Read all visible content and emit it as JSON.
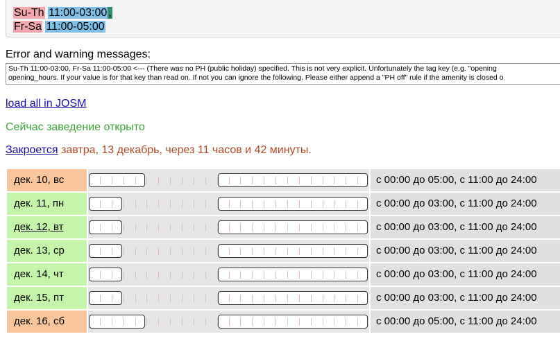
{
  "input": {
    "lines": [
      {
        "day": "Su-Th",
        "time": "11:00-03:00",
        "sep": ","
      },
      {
        "day": "Fr-Sa",
        "time": "11:00-05:00",
        "sep": ""
      }
    ]
  },
  "errors": {
    "label": "Error and warning messages:",
    "line1": "Su-Th 11:00-03:00, Fr-Sa 11:00-05:00 <--- (There was no PH (public holiday) specified. This is not very explicit. Unfortunately the tag key (e.g. \"opening",
    "line2": "opening_hours. If your value is for that key than read on. If not you can ignore the following. Please either append a \"PH off\" rule if the amenity is closed o"
  },
  "josm_link": "load all in JOSM",
  "status": {
    "open_text": "Сейчас заведение открыто",
    "closes_link": "Закроется",
    "closes_rest": " завтра, 13 декабрь, через 11 часов и 42 минуты."
  },
  "colors": {
    "weekend": "#f9c69c",
    "weekday": "#c5f5a9",
    "link": "#1a0dab",
    "open": "#3ea33a",
    "closes": "#b24a2a"
  },
  "days": [
    {
      "label": "дек. 10, вс",
      "type": "weekend",
      "underlined": false,
      "open_from_hour": 0,
      "open_until_hour": 5,
      "reopen_hour": 11,
      "desc": "с 00:00 до 05:00, с 11:00 до 24:00"
    },
    {
      "label": "дек. 11, пн",
      "type": "weekday",
      "underlined": false,
      "open_from_hour": 0,
      "open_until_hour": 3,
      "reopen_hour": 11,
      "desc": "с 00:00 до 03:00, с 11:00 до 24:00"
    },
    {
      "label": "дек. 12, вт",
      "type": "weekday",
      "underlined": true,
      "open_from_hour": 0,
      "open_until_hour": 3,
      "reopen_hour": 11,
      "desc": "с 00:00 до 03:00, с 11:00 до 24:00"
    },
    {
      "label": "дек. 13, ср",
      "type": "weekday",
      "underlined": false,
      "open_from_hour": 0,
      "open_until_hour": 3,
      "reopen_hour": 11,
      "desc": "с 00:00 до 03:00, с 11:00 до 24:00"
    },
    {
      "label": "дек. 14, чт",
      "type": "weekday",
      "underlined": false,
      "open_from_hour": 0,
      "open_until_hour": 3,
      "reopen_hour": 11,
      "desc": "с 00:00 до 03:00, с 11:00 до 24:00"
    },
    {
      "label": "дек. 15, пт",
      "type": "weekday",
      "underlined": false,
      "open_from_hour": 0,
      "open_until_hour": 3,
      "reopen_hour": 11,
      "desc": "с 00:00 до 03:00, с 11:00 до 24:00"
    },
    {
      "label": "дек. 16, сб",
      "type": "weekend",
      "underlined": false,
      "open_from_hour": 0,
      "open_until_hour": 5,
      "reopen_hour": 11,
      "desc": "с 00:00 до 05:00, с 11:00 до 24:00"
    }
  ]
}
